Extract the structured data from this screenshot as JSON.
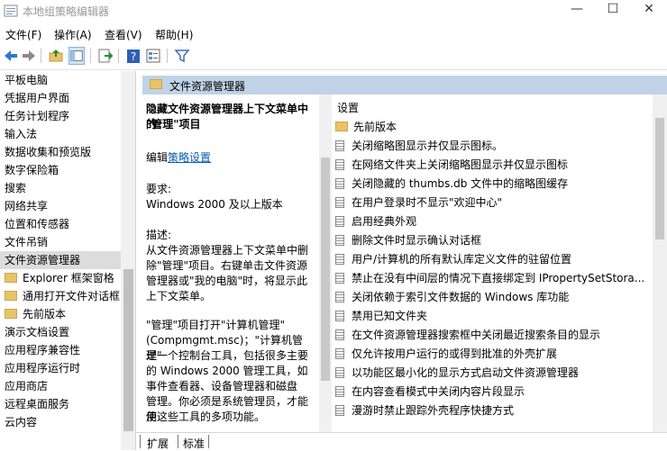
{
  "window": {
    "title": "本地组策略编辑器",
    "minimize_glyph": "—",
    "maximize_glyph": "☐",
    "close_glyph": "✕"
  },
  "menu": [
    "文件(F)",
    "操作(A)",
    "查看(V)",
    "帮助(H)"
  ],
  "toolbar": {
    "icons": [
      "back-icon",
      "forward-icon",
      "up-folder-icon",
      "show-hide-tree-icon",
      "export-list-icon",
      "help-icon",
      "properties-icon",
      "filter-icon"
    ]
  },
  "tree": {
    "items": [
      {
        "label": "平板电脑",
        "folder": false
      },
      {
        "label": "凭据用户界面",
        "folder": false
      },
      {
        "label": "任务计划程序",
        "folder": false
      },
      {
        "label": "输入法",
        "folder": false
      },
      {
        "label": "数据收集和预览版",
        "folder": false
      },
      {
        "label": "数字保险箱",
        "folder": false
      },
      {
        "label": "搜索",
        "folder": false
      },
      {
        "label": "网络共享",
        "folder": false
      },
      {
        "label": "位置和传感器",
        "folder": false
      },
      {
        "label": "文件吊销",
        "folder": false
      },
      {
        "label": "文件资源管理器",
        "folder": false,
        "selected": true
      },
      {
        "label": "Explorer 框架窗格",
        "folder": true
      },
      {
        "label": "通用打开文件对话框",
        "folder": true
      },
      {
        "label": "先前版本",
        "folder": true
      },
      {
        "label": "演示文档设置",
        "folder": false
      },
      {
        "label": "应用程序兼容性",
        "folder": false
      },
      {
        "label": "应用程序运行时",
        "folder": false
      },
      {
        "label": "应用商店",
        "folder": false
      },
      {
        "label": "远程桌面服务",
        "folder": false
      },
      {
        "label": "云内容",
        "folder": false
      }
    ]
  },
  "right": {
    "header_title": "文件资源管理器",
    "description": {
      "title_line1": "隐藏文件资源管理器上下文菜单中的",
      "title_line2": "\"管理\"项目",
      "edit_prefix": "编辑",
      "edit_link": "策略设置",
      "req_label": "要求:",
      "req_value": "Windows 2000 及以上版本",
      "desc_label": "描述:",
      "desc_lines": [
        "从文件资源管理器上下文菜单中删",
        "除\"管理\"项目。右键单击文件资源",
        "管理器或\"我的电脑\"时，将显示此",
        "上下文菜单。"
      ],
      "more_lines": [
        "\"管理\"项目打开\"计算机管理\"",
        "(Compmgmt.msc)；\"计算机管理\"",
        "是一个控制台工具，包括很多主要",
        "的 Windows 2000 管理工具，如",
        "事件查看器、设备管理器和磁盘",
        "管理。你必须是系统管理员，才能使",
        "用这些工具的多项功能。"
      ]
    },
    "list": {
      "column_header": "设置",
      "items": [
        {
          "label": "先前版本",
          "type": "folder"
        },
        {
          "label": "关闭缩略图显示并仅显示图标。",
          "type": "setting"
        },
        {
          "label": "在网络文件夹上关闭缩略图显示并仅显示图标",
          "type": "setting"
        },
        {
          "label": "关闭隐藏的 thumbs.db 文件中的缩略图缓存",
          "type": "setting"
        },
        {
          "label": "在用户登录时不显示\"欢迎中心\"",
          "type": "setting"
        },
        {
          "label": "启用经典外观",
          "type": "setting"
        },
        {
          "label": "删除文件时显示确认对话框",
          "type": "setting"
        },
        {
          "label": "用户/计算机的所有默认库定义文件的驻留位置",
          "type": "setting"
        },
        {
          "label": "禁止在没有中间层的情况下直接绑定到 IPropertySetStora...",
          "type": "setting"
        },
        {
          "label": "关闭依赖于索引文件数据的 Windows 库功能",
          "type": "setting"
        },
        {
          "label": "禁用已知文件夹",
          "type": "setting"
        },
        {
          "label": "在文件资源管理器搜索框中关闭最近搜索条目的显示",
          "type": "setting"
        },
        {
          "label": "仅允许按用户运行的或得到批准的外壳扩展",
          "type": "setting"
        },
        {
          "label": "以功能区最小化的显示方式启动文件资源管理器",
          "type": "setting"
        },
        {
          "label": "在内容查看模式中关闭内容片段显示",
          "type": "setting"
        },
        {
          "label": "漫游时禁止跟踪外壳程序快捷方式",
          "type": "setting"
        }
      ]
    }
  },
  "tabs": [
    "扩展",
    "标准"
  ]
}
